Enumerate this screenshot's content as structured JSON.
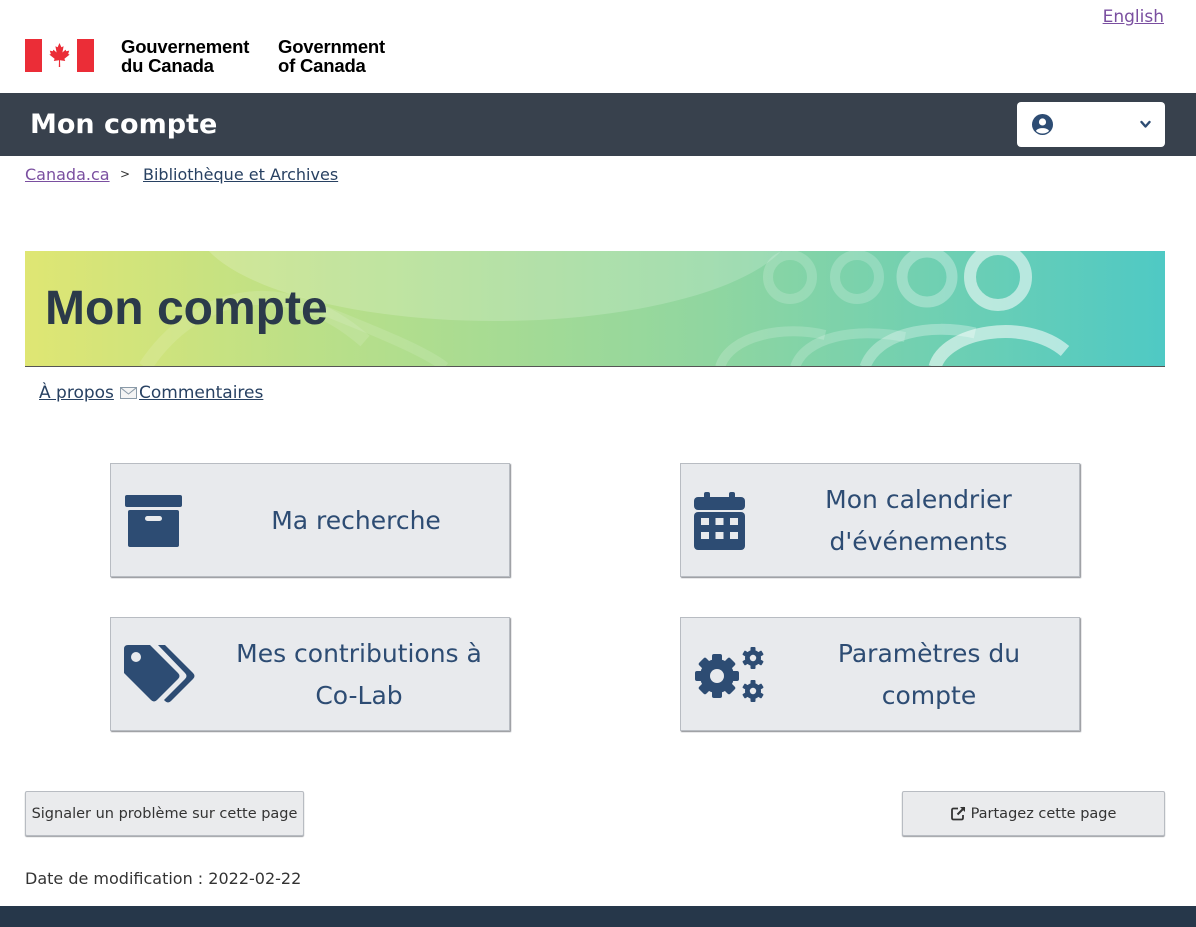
{
  "header": {
    "language_toggle": "English",
    "wordmark_fr_line1": "Gouvernement",
    "wordmark_fr_line2": "du Canada",
    "wordmark_en_line1": "Government",
    "wordmark_en_line2": "of Canada",
    "flag_icon": "canada-flag-icon"
  },
  "app_bar": {
    "title": "Mon compte",
    "account_icon": "user-circle-icon",
    "dropdown_icon": "chevron-down-icon"
  },
  "breadcrumb": {
    "items": [
      "Canada.ca",
      "Bibliothèque et Archives"
    ],
    "separator": ">"
  },
  "banner": {
    "title": "Mon compte"
  },
  "sub_links": {
    "about": "À propos",
    "feedback": "Commentaires",
    "feedback_icon": "envelope-icon"
  },
  "tiles": [
    {
      "line1": "Ma recherche",
      "line2": "",
      "icon": "archive-box-icon"
    },
    {
      "line1": "Mon calendrier",
      "line2": "d'événements",
      "icon": "calendar-icon"
    },
    {
      "line1": "Mes contributions à",
      "line2": "Co-Lab",
      "icon": "tags-icon"
    },
    {
      "line1": "Paramètres du",
      "line2": "compte",
      "icon": "gears-icon"
    }
  ],
  "actions": {
    "report_problem": "Signaler un problème sur cette page",
    "share_page": "Partagez cette page",
    "share_icon": "share-icon"
  },
  "date_modified": "Date de modification : 2022-02-22",
  "colors": {
    "app_bar": "#38414d",
    "tile_text": "#2d4c73",
    "link": "#284162",
    "visited_link": "#7a4fa0",
    "footer": "#26374a"
  }
}
